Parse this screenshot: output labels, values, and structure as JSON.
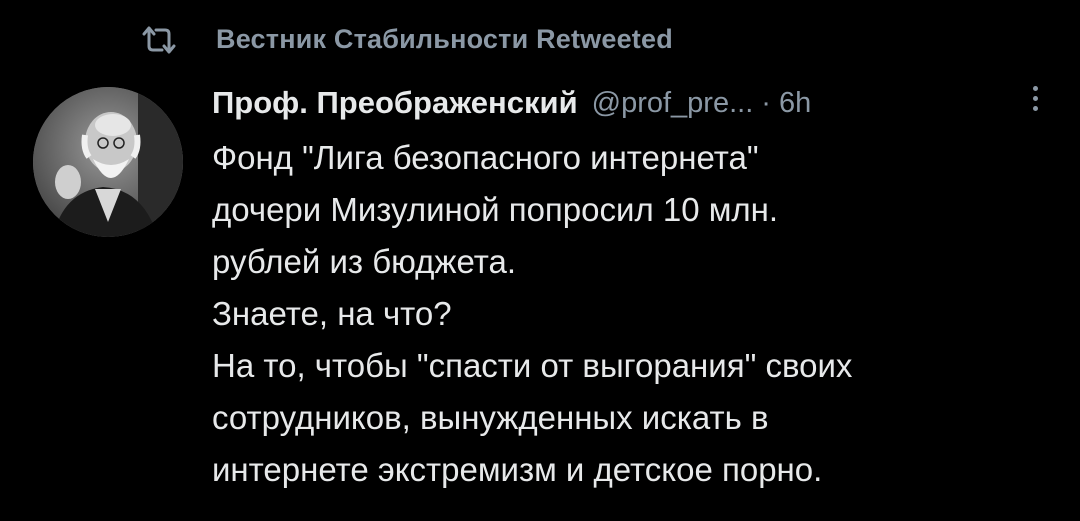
{
  "retweet": {
    "text": "Вестник Стабильности Retweeted",
    "icon": "retweet-icon"
  },
  "author": {
    "name": "Проф. Преображенский",
    "handle": "@prof_pre...",
    "separator": "·",
    "time": "6h",
    "avatar_icon": "avatar-photo"
  },
  "tweet": {
    "lines": [
      "Фонд \"Лига безопасного интернета\"",
      "дочери Мизулиной попросил 10 млн.",
      "рублей из бюджета.",
      "Знаете, на что?",
      "На то, чтобы \"спасти от выгорания\" своих",
      "сотрудников, вынужденных искать в",
      "интернете экстремизм и детское порно."
    ]
  },
  "colors": {
    "background": "#000000",
    "text": "#e7e9ea",
    "secondary": "#8b98a5"
  },
  "icons": {
    "more": "more-vertical-icon"
  }
}
